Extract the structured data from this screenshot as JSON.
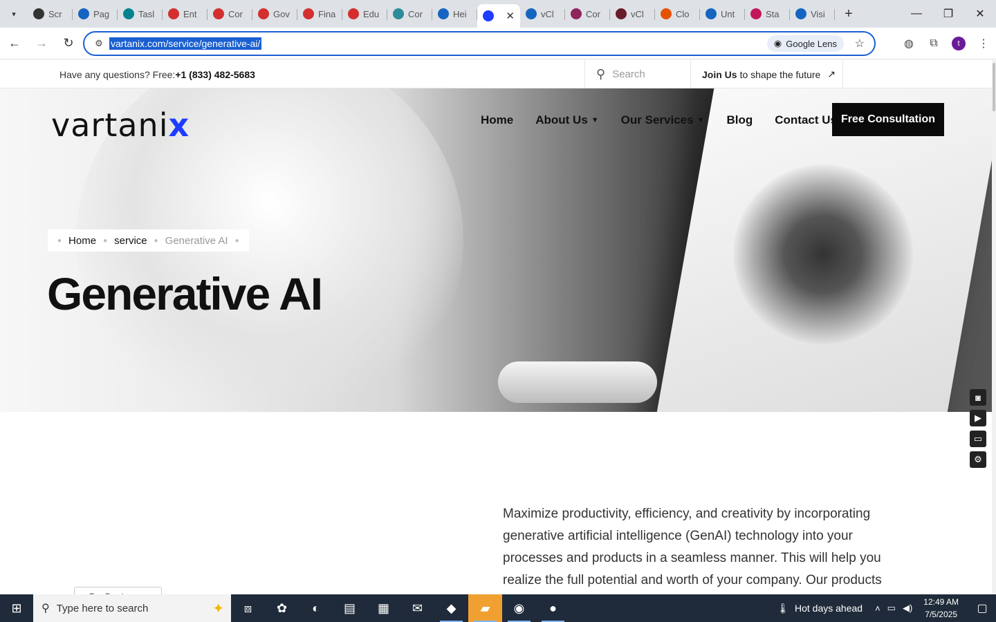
{
  "browser": {
    "tabs": [
      {
        "label": "Scr",
        "color": "#333333"
      },
      {
        "label": "Pag",
        "color": "#1565c0"
      },
      {
        "label": "Tasl",
        "color": "#00838f"
      },
      {
        "label": "Ent",
        "color": "#d32f2f"
      },
      {
        "label": "Cor",
        "color": "#d32f2f"
      },
      {
        "label": "Gov",
        "color": "#d32f2f"
      },
      {
        "label": "Fina",
        "color": "#d32f2f"
      },
      {
        "label": "Edu",
        "color": "#d32f2f"
      },
      {
        "label": "Cor",
        "color": "#2e8b9a"
      },
      {
        "label": "Hei",
        "color": "#1565c0"
      },
      {
        "label": "",
        "color": "#1e3cff",
        "active": true
      },
      {
        "label": "vCl",
        "color": "#1565c0"
      },
      {
        "label": "Cor",
        "color": "#8e2459"
      },
      {
        "label": "vCl",
        "color": "#6a1b2a"
      },
      {
        "label": "Clo",
        "color": "#e65100"
      },
      {
        "label": "Unt",
        "color": "#1565c0"
      },
      {
        "label": "Sta",
        "color": "#c2185b"
      },
      {
        "label": "Visi",
        "color": "#1565c0"
      }
    ],
    "url": "vartanix.com/service/generative-ai/",
    "lens_label": "Google Lens",
    "avatar_letter": "t"
  },
  "site": {
    "topbar": {
      "question": "Have any questions? Free:",
      "phone": "+1 (833) 482-5683",
      "search_placeholder": "Search",
      "join_bold": "Join Us",
      "join_rest": "to shape the future",
      "join_arrow": "↗"
    },
    "logo": {
      "text": "vartani",
      "accent": "x"
    },
    "nav": [
      {
        "label": "Home",
        "dropdown": false
      },
      {
        "label": "About Us",
        "dropdown": true
      },
      {
        "label": "Our Services",
        "dropdown": true
      },
      {
        "label": "Blog",
        "dropdown": false
      },
      {
        "label": "Contact Us",
        "dropdown": false
      }
    ],
    "cta": "Free Consultation",
    "breadcrumb": [
      "Home",
      "service",
      "Generative AI"
    ],
    "title": "Generative AI",
    "intro": "Maximize productivity, efficiency, and creativity by incorporating generative artificial intelligence (GenAI) technology into your processes and products in a seamless manner. This will help you realize the full potential and worth of your company. Our products",
    "pill_text": "Our Services"
  },
  "taskbar": {
    "search_placeholder": "Type here to search",
    "weather": "Hot days ahead",
    "time": "12:49 AM",
    "date": "7/5/2025"
  },
  "colors": {
    "accent": "#1e3cff",
    "url_highlight": "#1a5fd1",
    "taskbar": "#1f2b3a"
  }
}
